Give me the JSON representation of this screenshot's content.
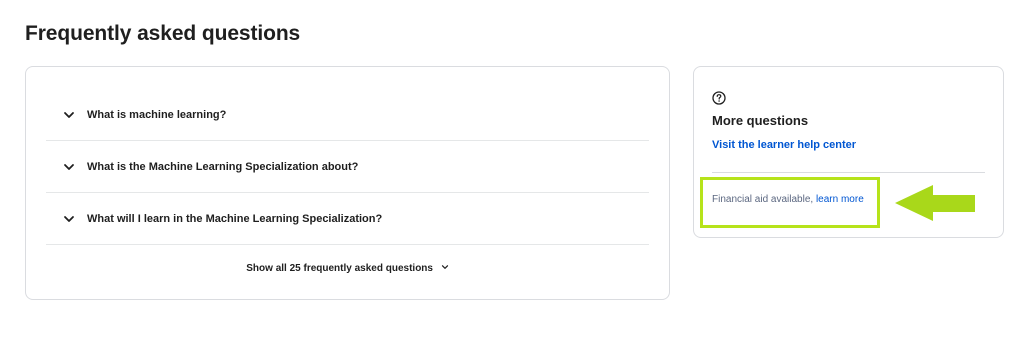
{
  "page": {
    "title": "Frequently asked questions"
  },
  "faq": {
    "items": [
      {
        "question": "What is machine learning?"
      },
      {
        "question": "What is the Machine Learning Specialization about?"
      },
      {
        "question": "What will I learn in the Machine Learning Specialization?"
      }
    ],
    "show_all_label": "Show all 25 frequently asked questions"
  },
  "more": {
    "title": "More questions",
    "help_link": "Visit the learner help center",
    "aid_text": "Financial aid available,",
    "aid_link": "learn more"
  },
  "colors": {
    "link": "#0056d2",
    "highlight": "#b6e31a",
    "text": "#1f1f1f"
  },
  "icons": {
    "faq_chevron": "chevron-down-icon",
    "help": "question-circle-icon",
    "annotation": "left-arrow-icon"
  }
}
